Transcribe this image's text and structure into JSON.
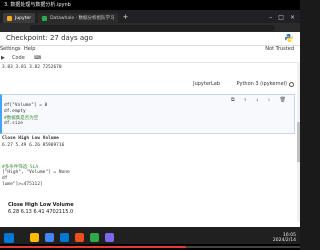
{
  "window": {
    "title": "3. 数据处理与数据分析.ipynb"
  },
  "tabs": [
    {
      "label": "Jupyter",
      "active": true
    },
    {
      "label": "Datawhale · 数据分析组队学习",
      "active": false
    }
  ],
  "jupyter": {
    "checkpoint": "Checkpoint: 27 days ago",
    "menu": [
      "Settings",
      "Help"
    ],
    "trust": "Not Trusted",
    "toolbar": [
      "▶",
      "Code",
      "⌨"
    ]
  },
  "kernel": {
    "jupyterlab": "JupyterLab",
    "name": "Python 3 (ipykernel)"
  },
  "cells": {
    "a": [
      "3.83   3.81   3.82   7252670"
    ],
    "b": [
      "df[\"Volume\"] = 0",
      "df.empty",
      "#数据集是否为空",
      "df.size"
    ],
    "c_header": "Close    High    Low     Volume",
    "c_row": "6.27     5.49    6.26    85909716",
    "d": [
      "#多条件筛选 SLA",
      "[\"High\", \"Volume\"] = None",
      "df",
      "lume\"]>=475112]"
    ],
    "e_header": "Close    High    Low     Volume",
    "e_row": "6.28     6.13    6.41    4702115.0"
  },
  "taskbar": {
    "time": "16:05",
    "date": "2024/2/14"
  },
  "video": {
    "progress": 0.62
  },
  "colors": {
    "accent": "#42a5f5",
    "jupyter_orange": "#f37726",
    "progress": "#e53935"
  }
}
